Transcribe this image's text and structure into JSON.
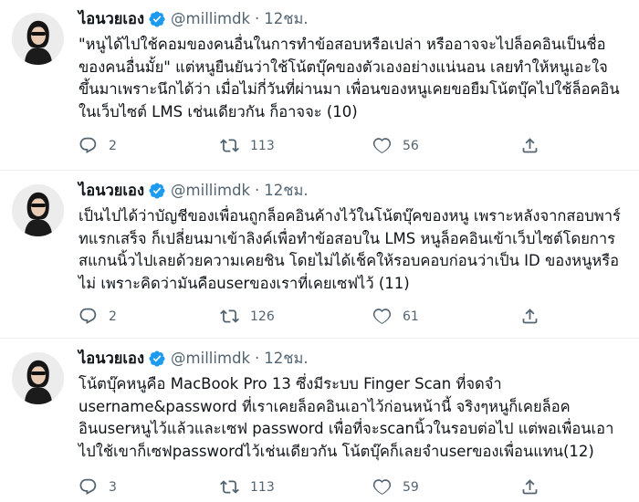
{
  "tweets": [
    {
      "author_name": "ไอนวยเอง",
      "handle": "@millimdk",
      "separator": "·",
      "time": "12ชม.",
      "text": "\"หนูได้ไปใช้คอมของคนอื่นในการทำข้อสอบหรือเปล่า หรืออาจจะไปล็อคอินเป็นชื่อของคนอื่นมั้ย\" แต่หนูยืนยันว่าใช้โน้ตบุ๊คของตัวเองอย่างแน่นอน เลยทำให้หนูเอะใจขึ้นมาเพราะนึกได้ว่า เมื่อไม่กี่วันที่ผ่านมา เพื่อนของหนูเคยขอยืมโน้ตบุ๊คไปใช้ล็อคอินในเว็บไซต์ LMS เช่นเดียวกัน ก็อาจจะ (10)",
      "replies": "2",
      "retweets": "113",
      "likes": "56"
    },
    {
      "author_name": "ไอนวยเอง",
      "handle": "@millimdk",
      "separator": "·",
      "time": "12ชม.",
      "text": "เป็นไปได้ว่าบัญชีของเพื่อนถูกล็อคอินค้างไว้ในโน้ตบุ๊คของหนู เพราะหลังจากสอบพาร์ทแรกเสร็จ ก็เปลี่ยนมาเข้าลิงค์เพื่อทำข้อสอบใน LMS หนูล็อคอินเข้าเว็บไซต์โดยการสแกนนิ้วไปเลยด้วยความเคยชิน โดยไม่ได้เช็คให้รอบคอบก่อนว่าเป็น ID ของหนูหรือไม่ เพราะคิดว่ามันคือuserของเราที่เคยเซฟไว้ (11)",
      "replies": "2",
      "retweets": "126",
      "likes": "61"
    },
    {
      "author_name": "ไอนวยเอง",
      "handle": "@millimdk",
      "separator": "·",
      "time": "12ชม.",
      "text": "โน้ตบุ๊คหนูคือ MacBook Pro 13 ซึ่งมีระบบ Finger Scan ที่จดจำ username&password ที่เราเคยล็อคอินเอาไว้ก่อนหน้านี้ จริงๆหนูก็เคยล็อคอินuserหนูไว้แล้วและเซฟ password เพื่อที่จะscanนิ้วในรอบต่อไป แต่พอเพื่อนเอาไปใช้เขาก็เซฟpasswordไว้เช่นเดียวกัน โน้ตบุ๊คก็เลยจำuserของเพื่อนแทน(12)",
      "replies": "3",
      "retweets": "113",
      "likes": "59"
    }
  ],
  "colors": {
    "text": "#0f1419",
    "muted": "#536471",
    "verified": "#1d9bf0",
    "divider": "#eff3f4"
  },
  "icons": {
    "reply": "reply-icon",
    "retweet": "retweet-icon",
    "like": "like-icon",
    "share": "share-icon",
    "verified": "verified-badge-icon"
  }
}
